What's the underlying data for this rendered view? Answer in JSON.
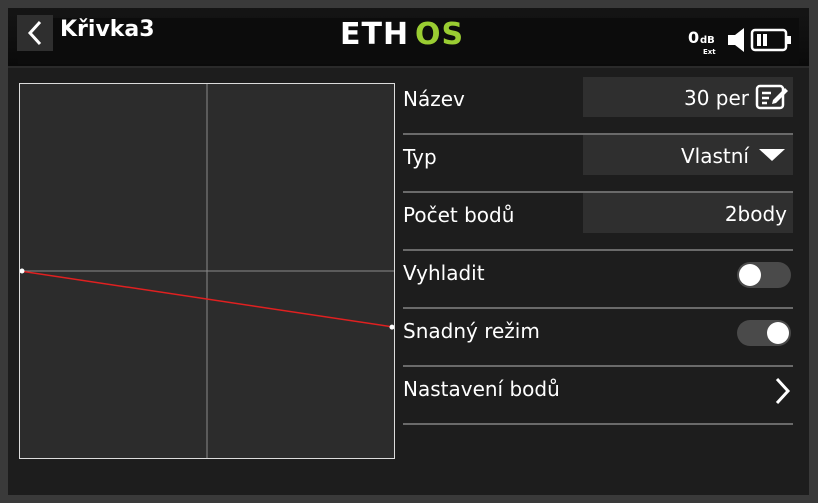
{
  "header": {
    "title": "Křivka3",
    "logo": "ETHOS",
    "volume": {
      "value": "0",
      "unit": "dB",
      "sub": "Ext"
    },
    "icons": [
      "back-chevron-icon",
      "speaker-icon",
      "battery-icon"
    ]
  },
  "curve": {
    "type": "line",
    "points": [
      {
        "x": -100,
        "y": 0
      },
      {
        "x": 100,
        "y": -30
      }
    ],
    "xlim": [
      -100,
      100
    ],
    "ylim": [
      -100,
      100
    ],
    "line_color": "#e02020",
    "grid_color": "#8a8a8a"
  },
  "settings": {
    "name": {
      "label": "Název",
      "value": "30 per",
      "icon": "edit-icon"
    },
    "type": {
      "label": "Typ",
      "value": "Vlastní",
      "icon": "dropdown-arrow-icon"
    },
    "points": {
      "label": "Počet bodů",
      "value": "2body"
    },
    "smooth": {
      "label": "Vyhladit",
      "on": false
    },
    "easy_mode": {
      "label": "Snadný režim",
      "on": true
    },
    "point_setup": {
      "label": "Nastavení bodů",
      "icon": "chevron-right-icon"
    }
  },
  "colors": {
    "accent": "#9acd32",
    "curve": "#e02020"
  }
}
